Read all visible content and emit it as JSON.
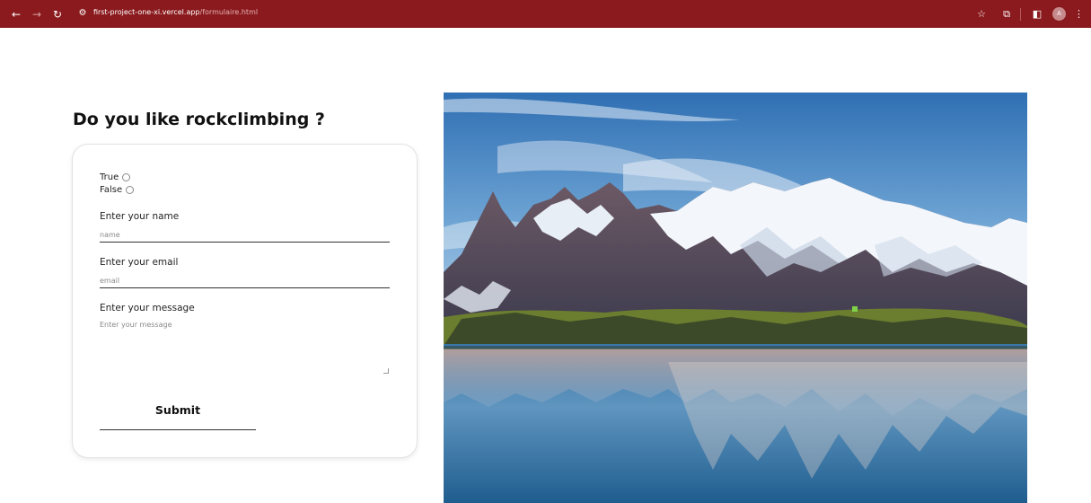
{
  "browser": {
    "url_host": "first-project-one-xi.vercel.app",
    "url_path": "/formulaire.html",
    "avatar_letter": "A",
    "chrome_color": "#8b1a1e",
    "icons": [
      "back-arrow-icon",
      "forward-arrow-icon",
      "reload-icon",
      "site-info-icon",
      "bookmark-star-icon",
      "extensions-icon",
      "side-panel-icon",
      "profile-avatar",
      "kebab-menu-icon"
    ]
  },
  "page": {
    "heading": "Do you like rockclimbing ?",
    "radio_true_label": "True",
    "radio_false_label": "False",
    "name_label": "Enter your name",
    "name_placeholder": "name",
    "email_label": "Enter your email",
    "email_placeholder": "email",
    "message_label": "Enter your message",
    "message_placeholder": "Enter your message",
    "submit_label": "Submit"
  }
}
